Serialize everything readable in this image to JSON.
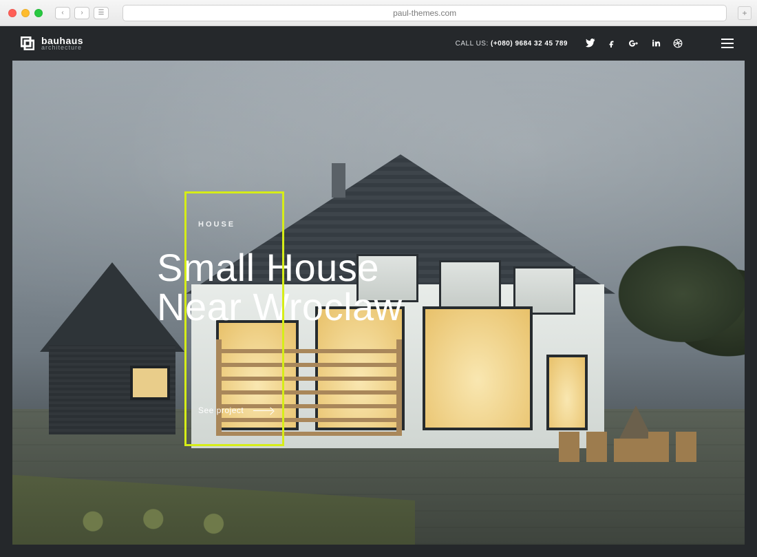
{
  "browser": {
    "url": "paul-themes.com"
  },
  "brand": {
    "name": "bauhaus",
    "tagline": "architecture"
  },
  "header": {
    "call_label": "CALL US: ",
    "phone": "(+080) 9684 32 45 789"
  },
  "social": {
    "items": [
      {
        "name": "twitter"
      },
      {
        "name": "facebook"
      },
      {
        "name": "google-plus"
      },
      {
        "name": "linkedin"
      },
      {
        "name": "dribbble"
      }
    ]
  },
  "hero": {
    "kicker": "HOUSE",
    "title": "Small House Near Wroclaw",
    "cta": "See project"
  },
  "colors": {
    "accent": "#d6ed17",
    "chrome": "#25282b"
  }
}
